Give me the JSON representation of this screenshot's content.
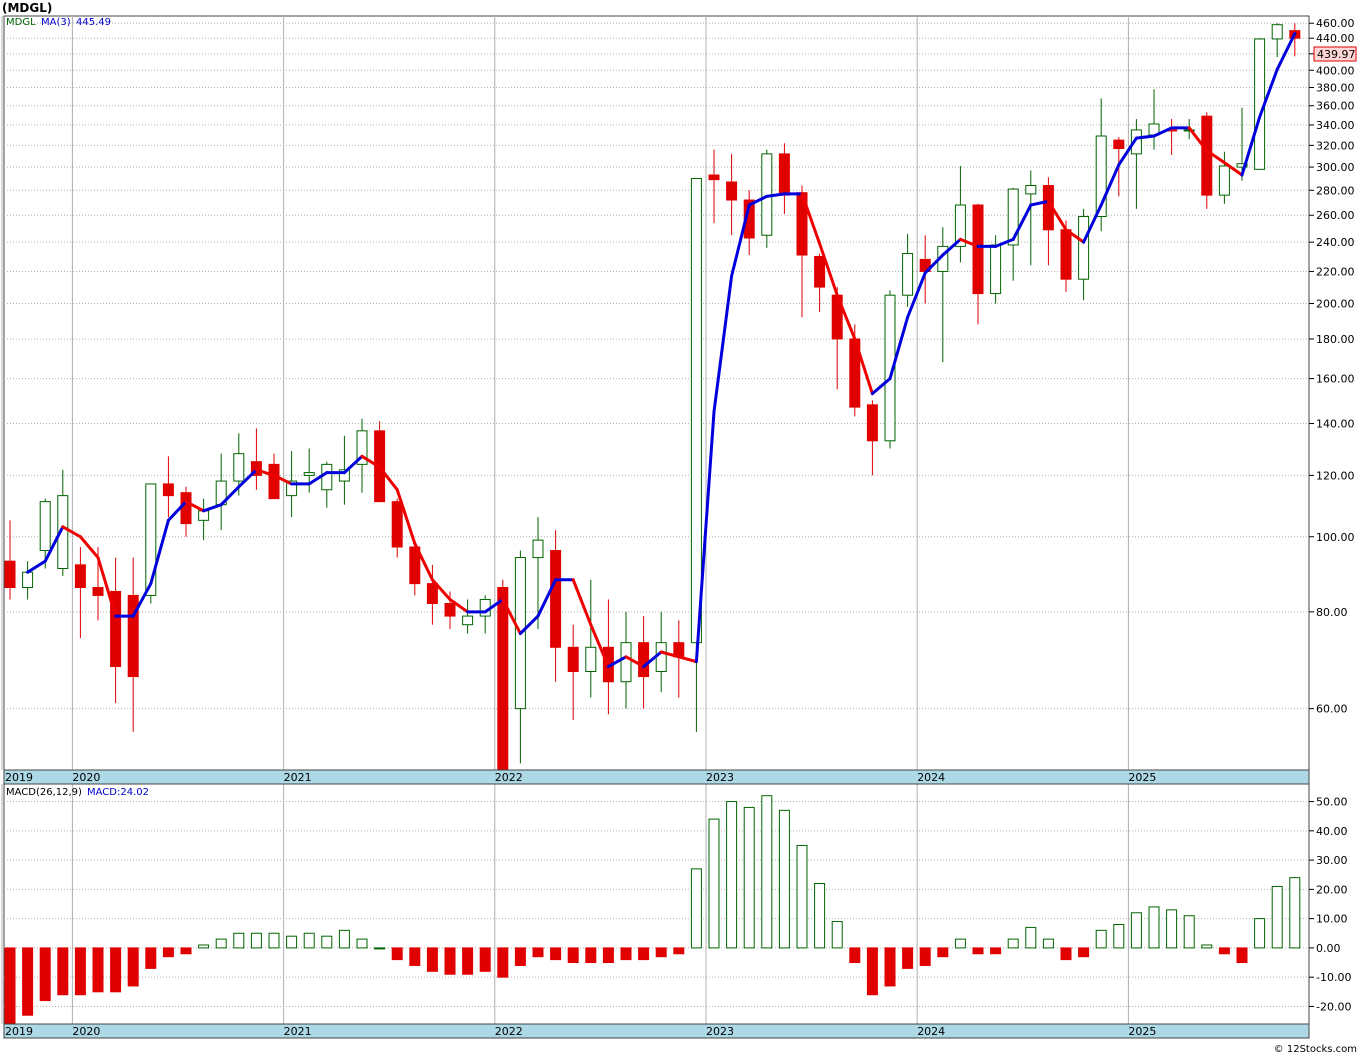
{
  "header": {
    "symbol": "(MDGL)",
    "legend_symbol": "MDGL",
    "legend_ma": "MA(3)",
    "legend_ma_value": "445.49",
    "last_price_label": "439.97",
    "macd_label": "MACD(26,12,9)",
    "macd_value_label": "MACD:24.02",
    "watermark": "© 12Stocks.com"
  },
  "colors": {
    "up": "#006400",
    "down": "#e00000",
    "ma_up": "#0000dd",
    "ma_down": "#ee0000",
    "axis_band": "#add8e6",
    "grid": "#b0b0b0"
  },
  "chart_data": [
    {
      "type": "candlestick",
      "title": "(MDGL)",
      "scale": "log",
      "ylim": [
        50,
        470
      ],
      "y_ticks": [
        60,
        80,
        100,
        120,
        140,
        160,
        180,
        200,
        220,
        240,
        260,
        280,
        300,
        320,
        340,
        360,
        380,
        400,
        420,
        440,
        460
      ],
      "y_tick_labels": [
        "60.00",
        "80.00",
        "100.00",
        "120.00",
        "140.00",
        "160.00",
        "180.00",
        "200.00",
        "220.00",
        "240.00",
        "260.00",
        "280.00",
        "300.00",
        "320.00",
        "340.00",
        "360.00",
        "380.00",
        "400.00",
        "420.00",
        "440.00",
        "460.00"
      ],
      "x_labels": [
        {
          "label": "2019",
          "index": 0
        },
        {
          "label": "2020",
          "index": 4
        },
        {
          "label": "2021",
          "index": 16
        },
        {
          "label": "2022",
          "index": 28
        },
        {
          "label": "2023",
          "index": 40
        },
        {
          "label": "2024",
          "index": 52
        },
        {
          "label": "2025",
          "index": 64
        }
      ],
      "ohlc": [
        [
          93,
          105,
          83,
          86
        ],
        [
          86,
          93,
          83,
          90
        ],
        [
          96,
          112,
          91,
          111
        ],
        [
          91,
          122,
          89,
          113
        ],
        [
          92,
          97,
          74,
          86
        ],
        [
          86,
          97,
          78,
          84
        ],
        [
          85,
          94,
          61,
          68
        ],
        [
          84,
          94,
          56,
          66
        ],
        [
          84,
          116,
          82,
          117
        ],
        [
          117,
          127,
          106,
          113
        ],
        [
          114,
          116,
          100,
          104
        ],
        [
          105,
          112,
          99,
          108
        ],
        [
          110,
          128,
          102,
          118
        ],
        [
          118,
          136,
          113,
          128
        ],
        [
          125,
          138,
          115,
          120
        ],
        [
          124,
          128,
          112,
          112
        ],
        [
          113,
          129,
          106,
          118
        ],
        [
          120,
          130,
          114,
          121
        ],
        [
          115,
          125,
          109,
          124
        ],
        [
          118,
          135,
          110,
          122
        ],
        [
          124,
          142,
          114,
          137
        ],
        [
          137,
          141,
          112,
          111
        ],
        [
          111,
          112,
          94,
          97
        ],
        [
          97,
          99,
          84,
          87
        ],
        [
          87,
          92,
          77,
          82
        ],
        [
          82,
          85,
          76,
          79
        ],
        [
          77,
          83,
          75,
          79
        ],
        [
          79,
          84,
          75,
          83
        ],
        [
          86,
          88,
          60,
          50
        ],
        [
          60,
          96,
          51,
          94
        ],
        [
          94,
          106,
          76,
          99
        ],
        [
          96,
          102,
          65,
          72
        ],
        [
          72,
          77,
          58,
          67
        ],
        [
          67,
          88,
          62,
          72
        ],
        [
          72,
          83,
          59,
          65
        ],
        [
          65,
          80,
          60,
          73
        ],
        [
          73,
          79,
          60,
          66
        ],
        [
          67,
          80,
          63,
          73
        ],
        [
          73,
          78,
          62,
          70
        ],
        [
          73,
          80,
          56,
          290
        ],
        [
          293,
          316,
          254,
          289
        ],
        [
          287,
          312,
          245,
          272
        ],
        [
          272,
          280,
          231,
          243
        ],
        [
          245,
          316,
          236,
          312
        ],
        [
          312,
          322,
          261,
          276
        ],
        [
          278,
          284,
          192,
          231
        ],
        [
          230,
          232,
          195,
          210
        ],
        [
          205,
          210,
          155,
          180
        ],
        [
          180,
          188,
          143,
          147
        ],
        [
          148,
          150,
          120,
          133
        ],
        [
          133,
          208,
          130,
          205
        ],
        [
          205,
          246,
          198,
          232
        ],
        [
          228,
          245,
          200,
          220
        ],
        [
          220,
          251,
          168,
          237
        ],
        [
          237,
          301,
          226,
          268
        ],
        [
          268,
          269,
          188,
          206
        ],
        [
          206,
          245,
          200,
          238
        ],
        [
          238,
          282,
          214,
          281
        ],
        [
          277,
          297,
          224,
          284
        ],
        [
          284,
          291,
          224,
          249
        ],
        [
          249,
          256,
          207,
          215
        ],
        [
          215,
          265,
          202,
          259
        ],
        [
          259,
          368,
          248,
          329
        ],
        [
          325,
          328,
          275,
          317
        ],
        [
          312,
          346,
          265,
          335
        ],
        [
          330,
          378,
          316,
          341
        ],
        [
          335,
          346,
          311,
          334
        ],
        [
          335,
          346,
          326,
          335
        ],
        [
          349,
          353,
          265,
          276
        ],
        [
          276,
          314,
          269,
          301
        ],
        [
          300,
          358,
          288,
          303
        ],
        [
          298,
          440,
          298,
          439
        ],
        [
          439,
          460,
          416,
          458
        ],
        [
          450,
          460,
          417,
          440
        ]
      ],
      "ma": [
        null,
        90,
        93,
        103,
        100,
        94,
        79,
        79,
        87,
        105,
        111,
        108,
        110,
        116,
        122,
        120,
        117,
        117,
        121,
        121,
        127,
        123,
        115,
        98,
        88,
        83,
        80,
        80,
        83,
        75,
        79,
        88,
        88,
        77,
        68,
        70,
        68,
        71,
        70,
        69,
        145,
        217,
        268,
        275,
        277,
        277,
        239,
        205,
        180,
        153,
        160,
        192,
        219,
        231,
        242,
        237,
        237,
        242,
        268,
        271,
        249,
        240,
        268,
        302,
        327,
        329,
        337,
        337,
        315,
        304,
        293,
        348,
        401,
        446
      ]
    },
    {
      "type": "bar",
      "title": "MACD(26,12,9)",
      "ylim": [
        -26,
        56
      ],
      "y_ticks": [
        -20,
        -10,
        0,
        10,
        20,
        30,
        40,
        50
      ],
      "y_tick_labels": [
        "-20.00",
        "-10.00",
        "0.00",
        "10.00",
        "20.00",
        "30.00",
        "40.00",
        "50.00"
      ],
      "x_labels": [
        {
          "label": "2019",
          "index": 0
        },
        {
          "label": "2020",
          "index": 4
        },
        {
          "label": "2021",
          "index": 16
        },
        {
          "label": "2022",
          "index": 28
        },
        {
          "label": "2023",
          "index": 40
        },
        {
          "label": "2024",
          "index": 52
        },
        {
          "label": "2025",
          "index": 64
        }
      ],
      "values": [
        -26,
        -23,
        -18,
        -16,
        -16,
        -15,
        -15,
        -13,
        -7,
        -3,
        -2,
        1,
        3,
        5,
        5,
        5,
        4,
        5,
        4,
        6,
        3,
        0,
        -4,
        -6,
        -8,
        -9,
        -9,
        -8,
        -10,
        -6,
        -3,
        -4,
        -5,
        -5,
        -5,
        -4,
        -4,
        -3,
        -2,
        27,
        44,
        50,
        48,
        52,
        47,
        35,
        22,
        9,
        -5,
        -16,
        -13,
        -7,
        -6,
        -3,
        3,
        -2,
        -2,
        3,
        7,
        3,
        -4,
        -3,
        6,
        8,
        12,
        14,
        13,
        11,
        1,
        -2,
        -5,
        10,
        21,
        24
      ],
      "last_value": 24.02
    }
  ]
}
